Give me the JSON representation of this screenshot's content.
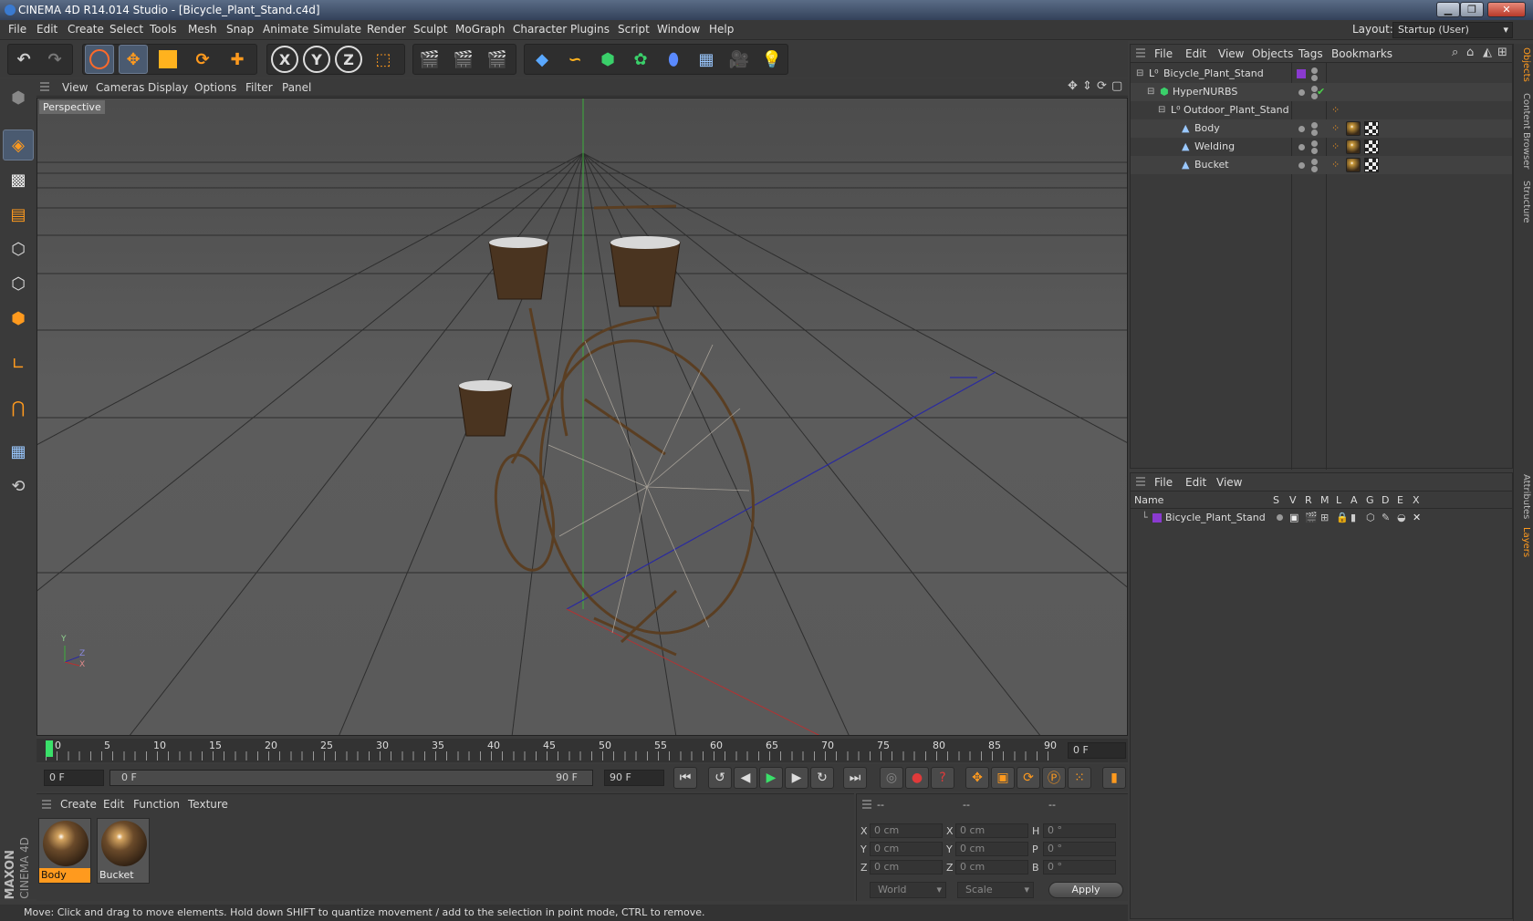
{
  "window": {
    "title": "CINEMA 4D R14.014 Studio - [Bicycle_Plant_Stand.c4d]"
  },
  "menu": [
    "File",
    "Edit",
    "Create",
    "Select",
    "Tools",
    "Mesh",
    "Snap",
    "Animate",
    "Simulate",
    "Render",
    "Sculpt",
    "MoGraph",
    "Character",
    "Plugins",
    "Script",
    "Window",
    "Help"
  ],
  "layout": {
    "label": "Layout:",
    "value": "Startup (User)"
  },
  "viewport": {
    "menu": [
      "View",
      "Cameras",
      "Display",
      "Options",
      "Filter",
      "Panel"
    ],
    "label": "Perspective",
    "axis_labels": {
      "y": "Y",
      "x": "X",
      "z": "Z"
    }
  },
  "timeline": {
    "ticks": [
      "0",
      "5",
      "10",
      "15",
      "20",
      "25",
      "30",
      "35",
      "40",
      "45",
      "50",
      "55",
      "60",
      "65",
      "70",
      "75",
      "80",
      "85",
      "90"
    ],
    "current_frame": "0 F",
    "start_field": "0 F",
    "range_start": "0 F",
    "range_end": "90 F",
    "end_field": "90 F"
  },
  "materials": {
    "menu": [
      "Create",
      "Edit",
      "Function",
      "Texture"
    ],
    "items": [
      {
        "name": "Body"
      },
      {
        "name": "Bucket"
      }
    ]
  },
  "coords": {
    "header": [
      "--",
      "--",
      "--"
    ],
    "rows": [
      {
        "a": "X",
        "av": "0 cm",
        "b": "X",
        "bv": "0 cm",
        "c": "H",
        "cv": "0 °"
      },
      {
        "a": "Y",
        "av": "0 cm",
        "b": "Y",
        "bv": "0 cm",
        "c": "P",
        "cv": "0 °"
      },
      {
        "a": "Z",
        "av": "0 cm",
        "b": "Z",
        "bv": "0 cm",
        "c": "B",
        "cv": "0 °"
      }
    ],
    "mode1": "World",
    "mode2": "Scale",
    "apply": "Apply"
  },
  "status": "Move: Click and drag to move elements. Hold down SHIFT to quantize movement / add to the selection in point mode, CTRL to remove.",
  "objects": {
    "menu": [
      "File",
      "Edit",
      "View",
      "Objects",
      "Tags",
      "Bookmarks"
    ],
    "tree": [
      {
        "name": "Bicycle_Plant_Stand"
      },
      {
        "name": "HyperNURBS"
      },
      {
        "name": "Outdoor_Plant_Stand"
      },
      {
        "name": "Body"
      },
      {
        "name": "Welding"
      },
      {
        "name": "Bucket"
      }
    ]
  },
  "layers": {
    "menu": [
      "File",
      "Edit",
      "View"
    ],
    "columns": [
      "Name",
      "S",
      "V",
      "R",
      "M",
      "L",
      "A",
      "G",
      "D",
      "E",
      "X"
    ],
    "rows": [
      {
        "name": "Bicycle_Plant_Stand"
      }
    ]
  },
  "side_tabs": [
    "Objects",
    "Content Browser",
    "Structure",
    "Attributes",
    "Layers"
  ],
  "brand": {
    "line1": "MAXON",
    "line2": "CINEMA 4D"
  },
  "colors": {
    "accent": "#ff9a1e",
    "layer_purple": "#8a3ad0",
    "check_green": "#4cd04c"
  }
}
